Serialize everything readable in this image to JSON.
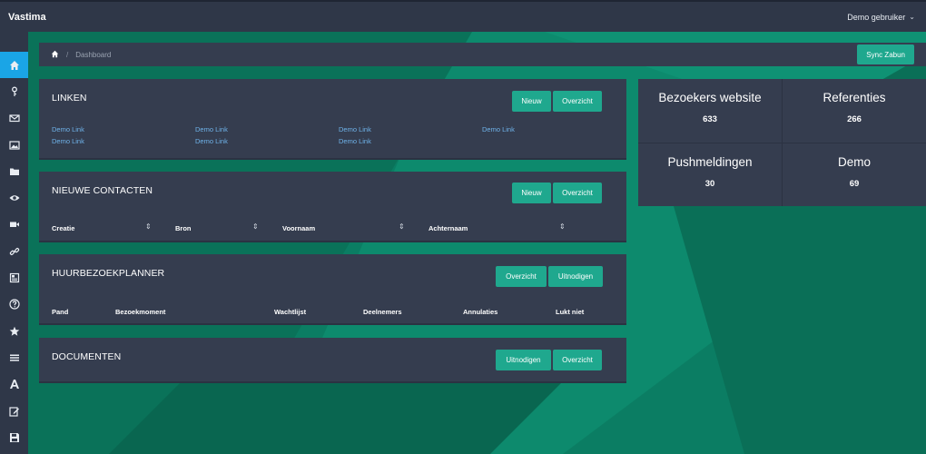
{
  "app": {
    "brand": "Vastima",
    "user": "Demo gebruiker"
  },
  "sidebar": {
    "items": [
      {
        "icon": "home-icon"
      },
      {
        "icon": "key-icon"
      },
      {
        "icon": "mail-icon"
      },
      {
        "icon": "image-icon"
      },
      {
        "icon": "folder-icon"
      },
      {
        "icon": "eye-icon"
      },
      {
        "icon": "video-icon"
      },
      {
        "icon": "link-icon"
      },
      {
        "icon": "newspaper-icon"
      },
      {
        "icon": "help-icon"
      },
      {
        "icon": "star-icon"
      },
      {
        "icon": "menu-icon"
      },
      {
        "icon": "font-icon"
      },
      {
        "icon": "edit-icon"
      },
      {
        "icon": "save-icon"
      }
    ]
  },
  "breadcrumb": {
    "current": "Dashboard",
    "sync_label": "Sync Zabun"
  },
  "panels": {
    "linken": {
      "title": "LINKEN",
      "btn_new": "Nieuw",
      "btn_overview": "Overzicht",
      "links": [
        "Demo Link",
        "Demo Link",
        "Demo Link",
        "Demo Link",
        "Demo Link",
        "Demo Link",
        "Demo Link"
      ]
    },
    "contacten": {
      "title": "NIEUWE CONTACTEN",
      "btn_new": "Nieuw",
      "btn_overview": "Overzicht",
      "columns": [
        "Creatie",
        "Bron",
        "Voornaam",
        "Achternaam"
      ]
    },
    "planner": {
      "title": "HUURBEZOEKPLANNER",
      "btn_overview": "Overzicht",
      "btn_invite": "Uitnodigen",
      "columns": [
        "Pand",
        "Bezoekmoment",
        "Wachtlijst",
        "Deelnemers",
        "Annulaties",
        "Lukt niet"
      ]
    },
    "documenten": {
      "title": "DOCUMENTEN",
      "btn_invite": "Uitnodigen",
      "btn_overview": "Overzicht"
    }
  },
  "stats": [
    {
      "label": "Bezoekers website",
      "value": "633"
    },
    {
      "label": "Referenties",
      "value": "266"
    },
    {
      "label": "Pushmeldingen",
      "value": "30"
    },
    {
      "label": "Demo",
      "value": "69"
    }
  ],
  "colors": {
    "accent": "#1fa88e",
    "panel": "#353d4f",
    "sidebar": "#2f3748",
    "active": "#1aa5e6",
    "background": "#0b7d63",
    "link": "#6fb3ea"
  }
}
